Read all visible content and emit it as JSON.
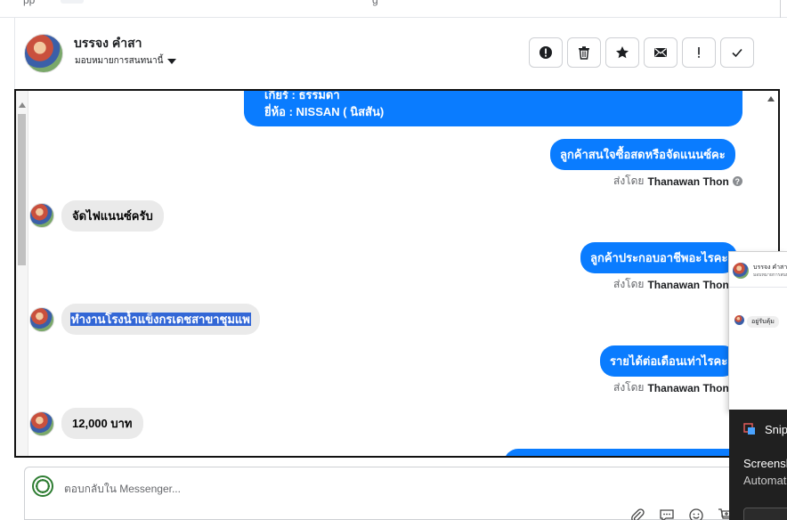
{
  "top_strip": {
    "left_text": "pp",
    "right_text": "g"
  },
  "header": {
    "contact_name": "บรรจง คำสา",
    "assign_label": "มอบหมายการสนทนานี้"
  },
  "actions": [
    {
      "name": "report-button",
      "icon": "alert-circle-icon"
    },
    {
      "name": "delete-button",
      "icon": "trash-icon"
    },
    {
      "name": "star-button",
      "icon": "star-icon"
    },
    {
      "name": "mark-unread-button",
      "icon": "envelope-icon"
    },
    {
      "name": "important-button",
      "icon": "exclamation-icon"
    },
    {
      "name": "done-button",
      "icon": "check-icon"
    }
  ],
  "conversation": {
    "top_bubble": {
      "line1": "เกียร์ : ธรรมดา",
      "line2": "ยี่ห้อ : NISSAN ( นิสสัน)"
    },
    "messages": [
      {
        "direction": "out",
        "text": "ลูกค้าสนใจซื้อสดหรือจัดแนนซ์คะ"
      },
      {
        "direction": "sentby",
        "prefix": "ส่งโดย",
        "sender": "Thanawan Thon"
      },
      {
        "direction": "in",
        "text": "จัดไฟแนนซ์ครับ"
      },
      {
        "direction": "out",
        "text": "ลูกค้าประกอบอาชีพอะไรคะ"
      },
      {
        "direction": "sentby",
        "prefix": "ส่งโดย",
        "sender": "Thanawan Thon"
      },
      {
        "direction": "in",
        "text": "ทำงานโรงน้ำแข็งกรเดชสาขาชุมแพ",
        "selected": true
      },
      {
        "direction": "out",
        "text": "รายได้ต่อเดือนเท่าไรคะ"
      },
      {
        "direction": "sentby",
        "prefix": "ส่งโดย",
        "sender": "Thanawan Thon"
      },
      {
        "direction": "in",
        "text": "12,000 บาท"
      }
    ]
  },
  "reply": {
    "placeholder": "ตอบกลับใน Messenger..."
  },
  "float_window": {
    "title": "บรรจง คำสา",
    "subtitle": "มอบหมายการสนทนานี้",
    "message": "อยู่รับคุ้ม"
  },
  "toast": {
    "app": "Snipping Tool",
    "line1": "Screenshot copied to clipboard",
    "line2": "Automatically saved to screenshots folder"
  },
  "colors": {
    "accent": "#0a7cff",
    "selection": "#3367d6",
    "incoming_bubble": "#eaeaea"
  }
}
